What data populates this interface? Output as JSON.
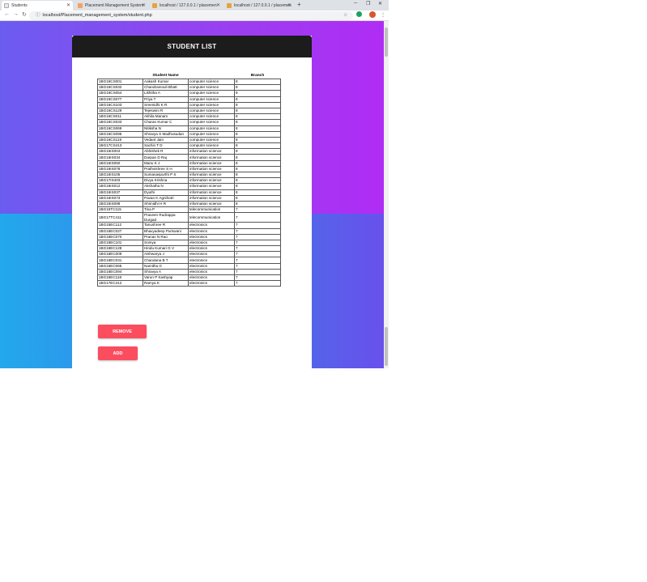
{
  "tabs": [
    {
      "label": "Students",
      "active": true,
      "color": "#e8e8e8"
    },
    {
      "label": "Placement Management System",
      "active": false,
      "color": "#f4a261"
    },
    {
      "label": "localhost / 127.0.0.1 / placemen",
      "active": false,
      "color": "#e9a23b"
    },
    {
      "label": "localhost / 127.0.0.1 / placemen",
      "active": false,
      "color": "#e9a23b"
    }
  ],
  "address_bar": {
    "url": "localhost/Placement_management_system/student.php"
  },
  "page": {
    "title": "STUDENT LIST",
    "columns": [
      "",
      "Student Name",
      "",
      "Branch"
    ],
    "rows": [
      [
        "1BG16CS001",
        "Aakash Kumar",
        "computer science",
        "8"
      ],
      [
        "1BG16CS032",
        "Chandramouli Bhatt",
        "computer science",
        "8"
      ],
      [
        "1BG16CS054",
        "Likhitha A",
        "computer science",
        "8"
      ],
      [
        "1BG16CS077",
        "Priya T",
        "computer science",
        "8"
      ],
      [
        "1BG16CS103",
        "Sreenidhi K R",
        "computer science",
        "8"
      ],
      [
        "1BG16CS129",
        "Tejeswini R",
        "computer science",
        "8"
      ],
      [
        "1BG16CS011",
        "Akhila Manam",
        "computer science",
        "8"
      ],
      [
        "1BG16CS033",
        "Charan Kumar C",
        "computer science",
        "8"
      ],
      [
        "1BG16CS069",
        "Nitiksha N",
        "computer science",
        "8"
      ],
      [
        "1BG16CS095",
        "Shravya S Madhusudan",
        "computer science",
        "8"
      ],
      [
        "1BG16CS119",
        "Vedant Jain",
        "computer science",
        "8"
      ],
      [
        "1BG17CS413",
        "Sachin T D",
        "computer science",
        "8"
      ],
      [
        "1BG16IS004",
        "Abhishek R",
        "information science",
        "8"
      ],
      [
        "1BG16IS034",
        "Darpan D Raj",
        "information science",
        "8"
      ],
      [
        "1BG16IS050",
        "Manu K J",
        "information science",
        "8"
      ],
      [
        "1BG16IS078",
        "Prathvishree S H",
        "information science",
        "8"
      ],
      [
        "1BG16IS105",
        "Sumanaspurthi P S",
        "information science",
        "8"
      ],
      [
        "1BG17IS403",
        "Divya Krishna",
        "information science",
        "8"
      ],
      [
        "1BG16IS012",
        "Akshatha N",
        "information science",
        "8"
      ],
      [
        "1BG16IS037",
        "Dyuthi",
        "information science",
        "8"
      ],
      [
        "1BG16IS073",
        "Pavan K Agnihotri",
        "information science",
        "8"
      ],
      [
        "1BG16IS098",
        "Shrinidhi H R",
        "information science",
        "8"
      ],
      [
        "1BG16TC115",
        "Tina P",
        "telecommunication",
        "7"
      ],
      [
        "1BG17TC411",
        "Praveen Rudrappa Durgad",
        "telecommunication",
        "7"
      ],
      [
        "1BG15EC112",
        "Tanushree R",
        "electronics",
        "7"
      ],
      [
        "1BG16EC027",
        "Bhavyadeep Purswani",
        "electronics",
        "7"
      ],
      [
        "1BG16EC070",
        "Pranav N Rao",
        "electronics",
        "7"
      ],
      [
        "1BG16EC101",
        "Somya",
        "electronics",
        "7"
      ],
      [
        "1BG16EC128",
        "Hindu Kumari G V",
        "electronics",
        "7"
      ],
      [
        "1BG16EC009",
        "Aishwarya J",
        "electronics",
        "7"
      ],
      [
        "1BG16EC031",
        "Chandana B T",
        "electronics",
        "7"
      ],
      [
        "1BG16EC065",
        "Namitha G",
        "electronics",
        "7"
      ],
      [
        "1BG16EC094",
        "Shravya A",
        "electronics",
        "7"
      ],
      [
        "1BG16EC118",
        "Varun P Kashyap",
        "electronics",
        "7"
      ],
      [
        "1BG17EC412",
        "Ramya K",
        "electronics",
        "7"
      ]
    ],
    "remove_label": "REMOVE",
    "add_label": "ADD"
  },
  "icons": {
    "back": "back-arrow-icon",
    "forward": "forward-arrow-icon",
    "reload": "reload-icon",
    "info": "info-icon",
    "star": "star-icon",
    "extension": "extension-icon",
    "profile": "profile-avatar-icon",
    "menu": "kebab-menu-icon"
  },
  "colors": {
    "button": "#fc4d5f",
    "header": "#1c1c1c",
    "gradient_top_left": "#6b5cf0",
    "gradient_top_right": "#b02cf5",
    "gradient_bottom_left": "#23a8ec",
    "gradient_bottom_right": "#6950ec"
  }
}
